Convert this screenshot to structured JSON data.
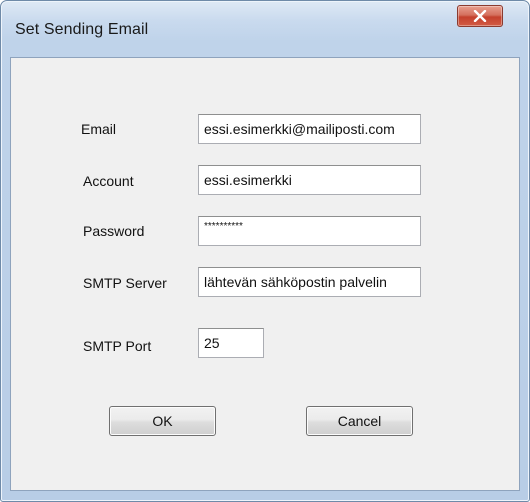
{
  "window": {
    "title": "Set Sending Email"
  },
  "titlebar": {
    "close_icon": "close-x-icon",
    "close_color": "#c4412d"
  },
  "form": {
    "email": {
      "label": "Email",
      "value": "essi.esimerkki@mailiposti.com"
    },
    "account": {
      "label": "Account",
      "value": "essi.esimerkki"
    },
    "password": {
      "label": "Password",
      "value": "**********"
    },
    "smtp_server": {
      "label": "SMTP Server",
      "value": "lähtevän sähköpostin palvelin"
    },
    "smtp_port": {
      "label": "SMTP Port",
      "value": "25"
    }
  },
  "buttons": {
    "ok_label": "OK",
    "cancel_label": "Cancel"
  }
}
